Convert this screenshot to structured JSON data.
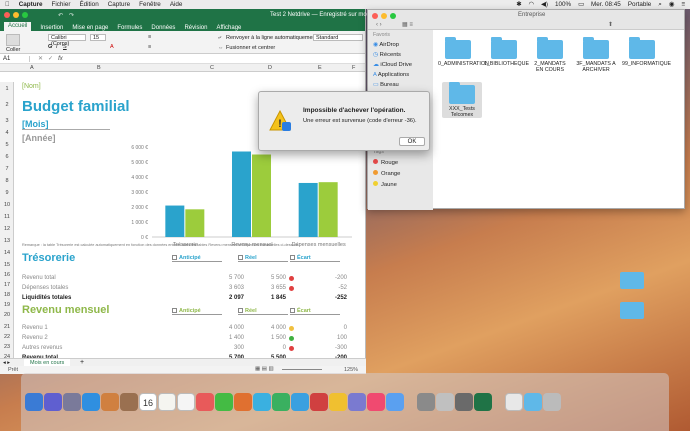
{
  "menubar": {
    "apple": "",
    "app": "Capture",
    "items": [
      "Fichier",
      "Édition",
      "Capture",
      "Fenêtre",
      "Aide"
    ],
    "battery": "100%",
    "clock": "Mer. 08:45",
    "user": "Portable"
  },
  "excel": {
    "title": "Test 2 Netdrive — Enregistré sur mon Mac",
    "tabs": [
      "Accueil",
      "Insertion",
      "Mise en page",
      "Formules",
      "Données",
      "Révision",
      "Affichage"
    ],
    "ribbon": {
      "paste": "Coller",
      "font": "Calibri (Corps)",
      "size": "15",
      "wrap": "Renvoyer à la ligne automatiquement",
      "merge": "Fusionner et centrer",
      "format": "Standard"
    },
    "cell_ref": "A1",
    "fx": "fx",
    "columns": [
      "A",
      "B",
      "C",
      "D",
      "E",
      "F"
    ],
    "rows": [
      "1",
      "2",
      "3",
      "4",
      "5",
      "6",
      "7",
      "8",
      "9",
      "10",
      "11",
      "12",
      "13",
      "14",
      "15",
      "16",
      "17",
      "18",
      "19",
      "20",
      "21",
      "22",
      "23",
      "24"
    ],
    "cells": {
      "nom": "[Nom]",
      "title": "Budget familial",
      "mois": "[Mois]",
      "annee": "[Année]",
      "note": "Remarque : la table Trésorerie est calculée automatiquement en fonction des données entrées dans les tables Revenu mensuel et Dépenses mensuelles ci-dessous",
      "treso_title": "Trésorerie",
      "rev_title": "Revenu mensuel",
      "hdr_anticipe": "Anticipé",
      "hdr_reel": "Réel",
      "hdr_ecart": "Écart",
      "treso_rows": [
        {
          "label": "Revenu total",
          "anticipe": "5 700",
          "reel": "5 500",
          "ecart": "-200",
          "dot": "#e04040"
        },
        {
          "label": "Dépenses totales",
          "anticipe": "3 603",
          "reel": "3 655",
          "ecart": "-52",
          "dot": "#e04040"
        },
        {
          "label": "Liquidités totales",
          "anticipe": "2 097",
          "reel": "1 845",
          "ecart": "-252",
          "dot": ""
        }
      ],
      "rev_rows": [
        {
          "label": "Revenu 1",
          "anticipe": "4 000",
          "reel": "4 000",
          "ecart": "0",
          "dot": "#f0c040"
        },
        {
          "label": "Revenu 2",
          "anticipe": "1 400",
          "reel": "1 500",
          "ecart": "100",
          "dot": "#40b040"
        },
        {
          "label": "Autres revenus",
          "anticipe": "300",
          "reel": "0",
          "ecart": "-300",
          "dot": "#e04040"
        },
        {
          "label": "Revenu total",
          "anticipe": "5 700",
          "reel": "5 500",
          "ecart": "-200",
          "dot": ""
        }
      ]
    },
    "sheet_tab": "Mois en cours",
    "status": "Prêt",
    "zoom": "125%"
  },
  "chart_data": {
    "type": "bar",
    "categories": [
      "Trésorerie",
      "Revenu mensuel",
      "Dépenses mensuelles"
    ],
    "series": [
      {
        "values": [
          2097,
          5700,
          3603
        ],
        "color": "#2aa3cc"
      },
      {
        "values": [
          1845,
          5500,
          3655
        ],
        "color": "#9ccc3c"
      }
    ],
    "yticks": [
      "0 €",
      "1 000 €",
      "2 000 €",
      "3 000 €",
      "4 000 €",
      "5 000 €",
      "6 000 €"
    ],
    "ylim": [
      0,
      6000
    ],
    "grid": false
  },
  "dialog": {
    "title": "Impossible d'achever l'opération.",
    "message": "Une erreur est survenue (code d'erreur -36).",
    "ok": "OK"
  },
  "finder": {
    "title": "Entreprise",
    "sidebar_header": "Favoris",
    "sidebar": [
      "AirDrop",
      "Récents",
      "iCloud Drive",
      "Applications",
      "Bureau"
    ],
    "tags_header": "Tags",
    "tags": [
      {
        "label": "Rouge",
        "color": "#e84a4a"
      },
      {
        "label": "Orange",
        "color": "#f09a30"
      },
      {
        "label": "Jaune",
        "color": "#f0d030"
      }
    ],
    "folders": [
      "0_ADMINISTRATION",
      "1_BIBLIOTHEQUE",
      "2_MANDATS EN COURS",
      "3F_MANDATS A ARCHIVER",
      "99_INFORMATIQUE",
      "XXX_Tests Telcomex"
    ]
  },
  "dock": {
    "calendar_day": "16",
    "icon_colors": [
      "#3a7bd5",
      "#5f5fd0",
      "#7a7a9a",
      "#2f8fe0",
      "#d08040",
      "#9a7050",
      "#ffffff",
      "#f5f5f0",
      "#f5f5f5",
      "#e85a5a",
      "#44bb44",
      "#e07030",
      "#3ab0e0",
      "#3ab060",
      "#3aa0e0",
      "#d04040",
      "#f0c030",
      "#7a7ad0",
      "#f04a70",
      "#5aa0f0",
      "#8a8a8a",
      "#c0c0c0",
      "#6a6a6a",
      "#1f7346",
      "#e8e8e8",
      "#5fb8e8",
      "#bbbbbb"
    ]
  }
}
